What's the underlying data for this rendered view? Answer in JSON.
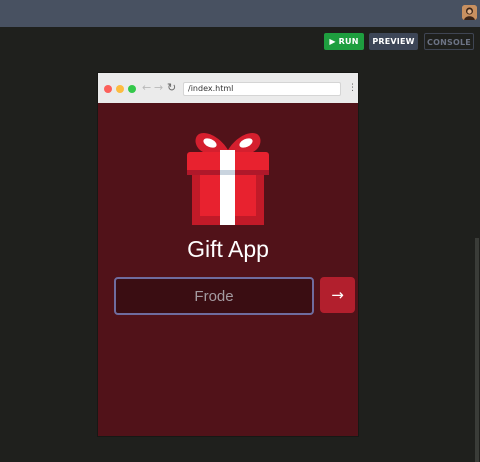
{
  "toolbar": {
    "run_label": "▶ RUN",
    "preview_label": "PREVIEW",
    "console_label": "CONSOLE"
  },
  "browser": {
    "url": "/index.html",
    "nav": {
      "back": "←",
      "forward": "→",
      "reload": "↻",
      "menu": "⋮"
    }
  },
  "app": {
    "title": "Gift App",
    "input_value": "Frode",
    "submit_label": "→",
    "icon": "gift-icon"
  },
  "colors": {
    "app_background": "#511219",
    "accent": "#b21f2d",
    "run_green": "#1e9e3f",
    "topbar": "#485161"
  }
}
